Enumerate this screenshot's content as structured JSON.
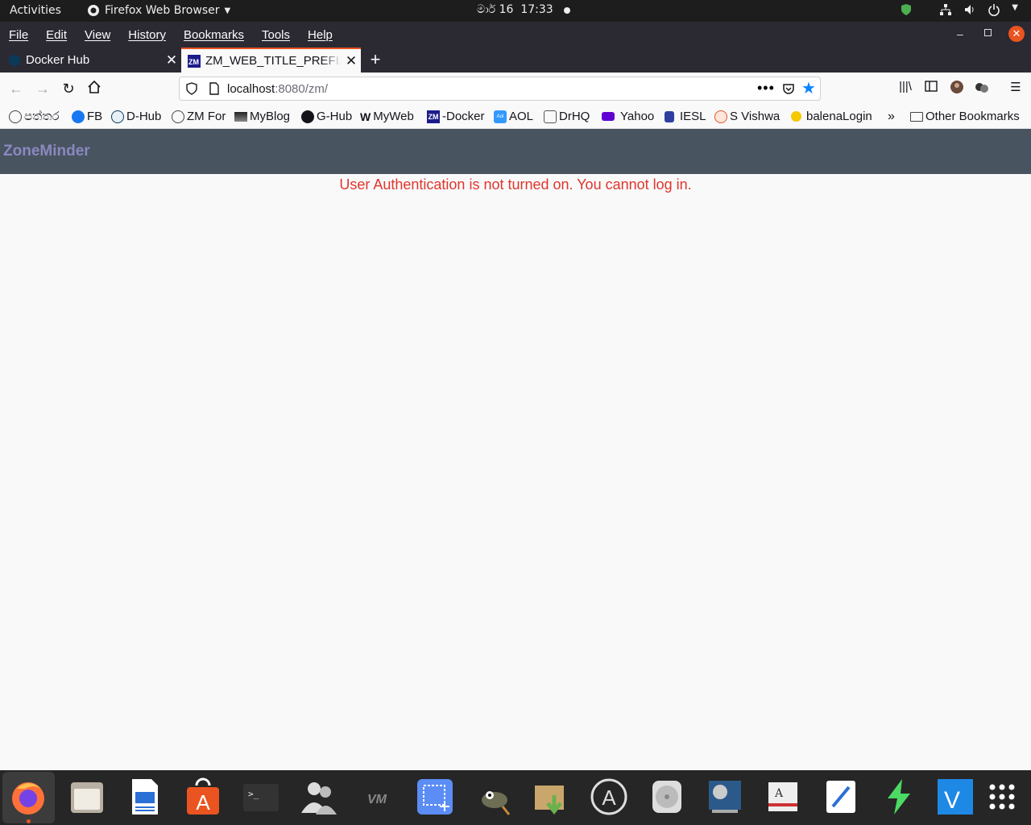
{
  "system_bar": {
    "activities": "Activities",
    "app_name": "Firefox Web Browser",
    "clock_date": "මාර් 16",
    "clock_time": "17:33"
  },
  "menu": {
    "items": [
      "File",
      "Edit",
      "View",
      "History",
      "Bookmarks",
      "Tools",
      "Help"
    ]
  },
  "tabs": [
    {
      "title": "Docker Hub",
      "active": false
    },
    {
      "title": "ZM_WEB_TITLE_PREFIX",
      "active": true
    }
  ],
  "address_bar": {
    "host": "localhost",
    "rest": ":8080/zm/"
  },
  "bookmarks": [
    {
      "label": "පත්තර",
      "icon": "globe-icon"
    },
    {
      "label": "FB",
      "icon": "facebook-icon"
    },
    {
      "label": "D-Hub",
      "icon": "docker-icon"
    },
    {
      "label": "ZM For",
      "icon": "globe-icon"
    },
    {
      "label": "MyBlog",
      "icon": "image-icon"
    },
    {
      "label": "G-Hub",
      "icon": "github-icon"
    },
    {
      "label": "MyWeb",
      "icon": "w-icon"
    },
    {
      "label": "-Docker",
      "icon": "zm-icon"
    },
    {
      "label": "AOL",
      "icon": "aol-icon"
    },
    {
      "label": "DrHQ",
      "icon": "box-icon"
    },
    {
      "label": "Yahoo",
      "icon": "mail-icon"
    },
    {
      "label": "IESL",
      "icon": "iesl-icon"
    },
    {
      "label": "S Vishwa",
      "icon": "ubuntu-icon"
    },
    {
      "label": "balenaLogin",
      "icon": "balena-icon"
    },
    {
      "label": "Other Bookmarks",
      "icon": "folder-icon"
    }
  ],
  "page": {
    "app_title": "ZoneMinder",
    "error_message": "User Authentication is not turned on. You cannot log in."
  },
  "colors": {
    "header_bg": "#485460",
    "title_color": "#8b88c0",
    "error_color": "#e0362c",
    "accent": "#e95420"
  },
  "dock": [
    "firefox-icon",
    "files-icon",
    "writer-icon",
    "software-center-icon",
    "terminal-icon",
    "users-icon",
    "vm-icon",
    "screenshot-icon",
    "gimp-icon",
    "archive-icon",
    "app-store-icon",
    "disk-icon",
    "video-icon",
    "dictionary-icon",
    "text-editor-icon",
    "flash-icon",
    "vscode-icon",
    "app-grid-icon"
  ]
}
